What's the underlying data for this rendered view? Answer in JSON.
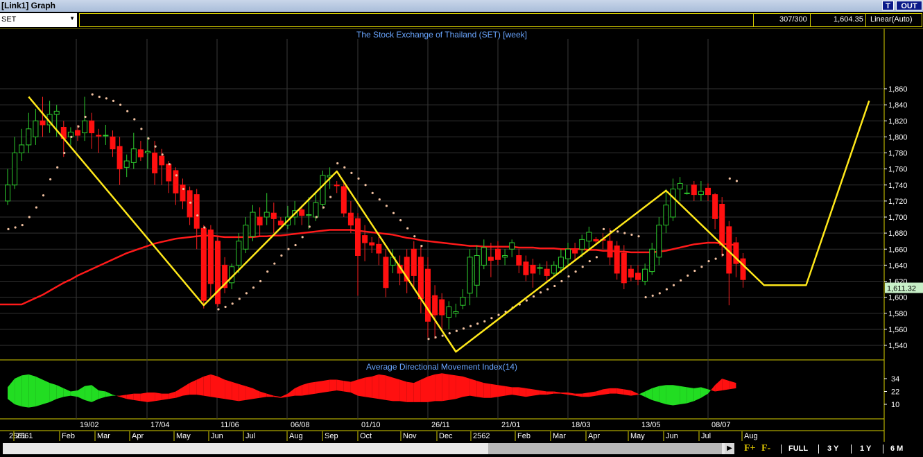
{
  "window": {
    "title": "[Link1] Graph",
    "btn_t": "T",
    "btn_out": "OUT"
  },
  "toolbar": {
    "symbol": "SET",
    "count": "307/300",
    "last_value": "1,604.35",
    "scale_mode": "Linear(Auto)"
  },
  "chart_data": [
    {
      "type": "candlestick",
      "title": "The Stock Exchange of Thailand (SET) [week]",
      "ylim": [
        1525,
        1870
      ],
      "yticks": [
        1540,
        1560,
        1580,
        1600,
        1620,
        1640,
        1660,
        1680,
        1700,
        1720,
        1740,
        1760,
        1780,
        1800,
        1820,
        1840,
        1860
      ],
      "ytick_labels": [
        "1,540",
        "1,560",
        "1,580",
        "1,600",
        "1,620",
        "1,640",
        "1,660",
        "1,680",
        "1,700",
        "1,720",
        "1,740",
        "1,760",
        "1,780",
        "1,800",
        "1,820",
        "1,840",
        "1,860"
      ],
      "last_price_label": "1,611.32",
      "last_price": 1611.32,
      "candles": [
        [
          1720,
          1740,
          1715,
          1760
        ],
        [
          1740,
          1780,
          1735,
          1800
        ],
        [
          1780,
          1790,
          1770,
          1810
        ],
        [
          1790,
          1810,
          1780,
          1830
        ],
        [
          1800,
          1820,
          1790,
          1835
        ],
        [
          1820,
          1815,
          1800,
          1850
        ],
        [
          1815,
          1828,
          1805,
          1845
        ],
        [
          1828,
          1832,
          1800,
          1840
        ],
        [
          1812,
          1798,
          1775,
          1820
        ],
        [
          1800,
          1806,
          1790,
          1812
        ],
        [
          1808,
          1802,
          1795,
          1815
        ],
        [
          1805,
          1820,
          1795,
          1850
        ],
        [
          1820,
          1805,
          1785,
          1830
        ],
        [
          1802,
          1801,
          1780,
          1810
        ],
        [
          1802,
          1802,
          1790,
          1815
        ],
        [
          1800,
          1785,
          1775,
          1808
        ],
        [
          1788,
          1760,
          1740,
          1800
        ],
        [
          1762,
          1770,
          1750,
          1778
        ],
        [
          1768,
          1785,
          1760,
          1805
        ],
        [
          1784,
          1775,
          1770,
          1795
        ],
        [
          1780,
          1782,
          1760,
          1800
        ],
        [
          1780,
          1755,
          1740,
          1795
        ],
        [
          1776,
          1765,
          1740,
          1785
        ],
        [
          1766,
          1745,
          1730,
          1770
        ],
        [
          1758,
          1730,
          1715,
          1762
        ],
        [
          1740,
          1720,
          1710,
          1748
        ],
        [
          1733,
          1700,
          1690,
          1738
        ],
        [
          1728,
          1686,
          1660,
          1735
        ],
        [
          1686,
          1596,
          1586,
          1690
        ],
        [
          1684,
          1617,
          1600,
          1690
        ],
        [
          1670,
          1592,
          1588,
          1675
        ],
        [
          1640,
          1612,
          1605,
          1650
        ],
        [
          1618,
          1638,
          1610,
          1642
        ],
        [
          1640,
          1670,
          1630,
          1680
        ],
        [
          1660,
          1690,
          1655,
          1700
        ],
        [
          1676,
          1706,
          1670,
          1715
        ],
        [
          1700,
          1690,
          1675,
          1712
        ],
        [
          1700,
          1706,
          1690,
          1730
        ],
        [
          1705,
          1698,
          1680,
          1718
        ],
        [
          1695,
          1690,
          1690,
          1700
        ],
        [
          1690,
          1700,
          1685,
          1714
        ],
        [
          1700,
          1708,
          1690,
          1720
        ],
        [
          1709,
          1702,
          1690,
          1715
        ],
        [
          1702,
          1703,
          1685,
          1725
        ],
        [
          1700,
          1718,
          1695,
          1730
        ],
        [
          1716,
          1752,
          1710,
          1758
        ],
        [
          1750,
          1752,
          1735,
          1762
        ],
        [
          1740,
          1739,
          1730,
          1745
        ],
        [
          1738,
          1705,
          1700,
          1745
        ],
        [
          1705,
          1690,
          1680,
          1720
        ],
        [
          1698,
          1652,
          1602,
          1705
        ],
        [
          1677,
          1668,
          1645,
          1690
        ],
        [
          1668,
          1665,
          1655,
          1675
        ],
        [
          1666,
          1655,
          1640,
          1675
        ],
        [
          1650,
          1612,
          1600,
          1660
        ],
        [
          1640,
          1650,
          1630,
          1660
        ],
        [
          1640,
          1630,
          1615,
          1652
        ],
        [
          1650,
          1620,
          1605,
          1660
        ],
        [
          1660,
          1627,
          1610,
          1670
        ],
        [
          1650,
          1598,
          1580,
          1665
        ],
        [
          1635,
          1570,
          1550,
          1650
        ],
        [
          1602,
          1578,
          1548,
          1615
        ],
        [
          1597,
          1578,
          1560,
          1605
        ],
        [
          1575,
          1588,
          1560,
          1595
        ],
        [
          1580,
          1582,
          1575,
          1592
        ],
        [
          1590,
          1600,
          1585,
          1610
        ],
        [
          1605,
          1650,
          1590,
          1660
        ],
        [
          1615,
          1652,
          1600,
          1665
        ],
        [
          1640,
          1662,
          1635,
          1672
        ],
        [
          1650,
          1646,
          1625,
          1668
        ],
        [
          1660,
          1647,
          1640,
          1670
        ],
        [
          1650,
          1652,
          1640,
          1660
        ],
        [
          1660,
          1668,
          1650,
          1672
        ],
        [
          1652,
          1640,
          1630,
          1660
        ],
        [
          1644,
          1628,
          1620,
          1652
        ],
        [
          1640,
          1630,
          1612,
          1648
        ],
        [
          1636,
          1637,
          1628,
          1642
        ],
        [
          1635,
          1627,
          1620,
          1645
        ],
        [
          1630,
          1640,
          1625,
          1645
        ],
        [
          1637,
          1650,
          1630,
          1660
        ],
        [
          1648,
          1660,
          1640,
          1668
        ],
        [
          1660,
          1655,
          1645,
          1668
        ],
        [
          1660,
          1672,
          1650,
          1678
        ],
        [
          1670,
          1681,
          1660,
          1688
        ],
        [
          1672,
          1670,
          1665,
          1675
        ],
        [
          1672,
          1671,
          1660,
          1680
        ],
        [
          1670,
          1650,
          1640,
          1686
        ],
        [
          1664,
          1630,
          1622,
          1670
        ],
        [
          1655,
          1618,
          1610,
          1665
        ],
        [
          1635,
          1625,
          1620,
          1640
        ],
        [
          1630,
          1622,
          1615,
          1640
        ],
        [
          1620,
          1635,
          1615,
          1642
        ],
        [
          1632,
          1660,
          1628,
          1668
        ],
        [
          1650,
          1690,
          1640,
          1700
        ],
        [
          1690,
          1715,
          1680,
          1735
        ],
        [
          1700,
          1735,
          1695,
          1748
        ],
        [
          1735,
          1742,
          1720,
          1750
        ],
        [
          1730,
          1730,
          1728,
          1740
        ],
        [
          1740,
          1728,
          1720,
          1745
        ],
        [
          1728,
          1732,
          1720,
          1745
        ],
        [
          1736,
          1728,
          1720,
          1742
        ],
        [
          1728,
          1698,
          1685,
          1730
        ],
        [
          1716,
          1665,
          1650,
          1725
        ],
        [
          1688,
          1630,
          1590,
          1695
        ],
        [
          1668,
          1642,
          1625,
          1675
        ],
        [
          1648,
          1622,
          1612,
          1655
        ]
      ],
      "sma": [
        1591,
        1591,
        1591,
        1595,
        1599,
        1603,
        1608,
        1613,
        1618,
        1622,
        1627,
        1631,
        1635,
        1639,
        1643,
        1647,
        1651,
        1655,
        1658,
        1661,
        1664,
        1667,
        1669,
        1671,
        1673,
        1674,
        1675,
        1676,
        1677,
        1677,
        1676,
        1675,
        1675,
        1675,
        1675,
        1675,
        1676,
        1676,
        1677,
        1677,
        1678,
        1679,
        1680,
        1681,
        1682,
        1683,
        1684,
        1684,
        1684,
        1684,
        1683,
        1682,
        1681,
        1680,
        1679,
        1678,
        1676,
        1674,
        1673,
        1671,
        1670,
        1669,
        1668,
        1667,
        1666,
        1665,
        1664,
        1664,
        1663,
        1663,
        1663,
        1663,
        1663,
        1662,
        1662,
        1662,
        1661,
        1661,
        1661,
        1660,
        1660,
        1660,
        1660,
        1659,
        1659,
        1658,
        1658,
        1657,
        1657,
        1656,
        1656,
        1656,
        1656,
        1657,
        1658,
        1660,
        1662,
        1664,
        1666,
        1667,
        1668,
        1668,
        1667,
        1666,
        1665
      ],
      "sar": [
        1685,
        1687,
        1690,
        1700,
        1712,
        1727,
        1747,
        1762,
        1780,
        1800,
        1813,
        1825,
        1853,
        1850,
        1848,
        1845,
        1840,
        1832,
        1822,
        1810,
        1798,
        1788,
        1778,
        1766,
        1752,
        1735,
        1718,
        1702,
        1687,
        null,
        1585,
        1588,
        1592,
        1598,
        1605,
        1612,
        1620,
        1632,
        1642,
        1652,
        1660,
        1665,
        1675,
        1688,
        1700,
        1712,
        1725,
        1767,
        1762,
        1755,
        1748,
        1740,
        1730,
        1722,
        1714,
        1705,
        1696,
        1686,
        1676,
        1664,
        1548,
        1550,
        1552,
        1555,
        1558,
        1561,
        1564,
        1567,
        1570,
        1574,
        1578,
        1582,
        1587,
        1591,
        1596,
        1601,
        1606,
        1610,
        1614,
        1620,
        1626,
        1632,
        1638,
        1645,
        1650,
        1685,
        1682,
        1682,
        1680,
        1678,
        1676,
        1600,
        1602,
        1605,
        1610,
        1615,
        1621,
        1627,
        1633,
        1638,
        1645,
        1648,
        1653,
        1748,
        1745
      ],
      "zigzag": [
        [
          3,
          1850
        ],
        [
          28,
          1590
        ],
        [
          47,
          1757
        ],
        [
          64,
          1532
        ],
        [
          94,
          1733
        ],
        [
          108,
          1615
        ],
        [
          114,
          1615
        ],
        [
          123,
          1845
        ]
      ]
    },
    {
      "type": "area",
      "title": "Average Directional Movement Index(14)",
      "yticks": [
        10,
        22,
        34
      ],
      "ytick_labels": [
        "10",
        "22",
        "34"
      ],
      "ylim": [
        3,
        42
      ],
      "plus_di": [
        26,
        34,
        37,
        38,
        36,
        33,
        30,
        28,
        25,
        22,
        23,
        27,
        28,
        23,
        22,
        19,
        17,
        15,
        14,
        13,
        12,
        13,
        14,
        15,
        16,
        18,
        19,
        19,
        18,
        17,
        16,
        15,
        14,
        13,
        14,
        15,
        16,
        17,
        17,
        16,
        17,
        18,
        18,
        19,
        20,
        21,
        22,
        23,
        22,
        21,
        18,
        17,
        16,
        15,
        14,
        13,
        13,
        12,
        12,
        12,
        12,
        13,
        13,
        14,
        15,
        17,
        18,
        17,
        16,
        16,
        17,
        18,
        19,
        18,
        17,
        18,
        19,
        19,
        20,
        20,
        19,
        18,
        17,
        17,
        18,
        19,
        20,
        20,
        19,
        18,
        19,
        22,
        25,
        27,
        28,
        28,
        27,
        26,
        25,
        26,
        24,
        22,
        23,
        24,
        25
      ],
      "minus_di": [
        15,
        10,
        8,
        7,
        8,
        10,
        12,
        15,
        17,
        18,
        17,
        14,
        12,
        15,
        17,
        18,
        18,
        19,
        20,
        20,
        21,
        21,
        20,
        20,
        22,
        26,
        30,
        33,
        36,
        38,
        36,
        33,
        31,
        29,
        27,
        25,
        22,
        20,
        18,
        17,
        20,
        25,
        28,
        30,
        31,
        32,
        33,
        33,
        32,
        31,
        33,
        35,
        36,
        38,
        37,
        35,
        33,
        31,
        30,
        33,
        36,
        38,
        39,
        38,
        37,
        36,
        34,
        32,
        30,
        29,
        28,
        27,
        26,
        26,
        25,
        24,
        23,
        22,
        22,
        21,
        21,
        20,
        20,
        21,
        22,
        24,
        25,
        25,
        24,
        23,
        20,
        17,
        14,
        12,
        10,
        9,
        10,
        11,
        13,
        16,
        20,
        28,
        34,
        32,
        30
      ]
    }
  ],
  "date_labels": [
    "19/02",
    "17/04",
    "11/06",
    "06/08",
    "01/10",
    "26/11",
    "21/01",
    "18/03",
    "13/05",
    "08/07"
  ],
  "month_labels": [
    "2561",
    "Feb",
    "Mar",
    "Apr",
    "May",
    "Jun",
    "Jul",
    "Aug",
    "Sep",
    "Oct",
    "Nov",
    "Dec",
    "2562",
    "Feb",
    "Mar",
    "Apr",
    "May",
    "Jun",
    "Jul",
    "Aug"
  ],
  "year_first": "2561",
  "bottom": {
    "full": "FULL",
    "r3y": "3 Y",
    "r1y": "1 Y",
    "r6m": "6 M",
    "fplus": "F+",
    "fminus": "F-"
  }
}
